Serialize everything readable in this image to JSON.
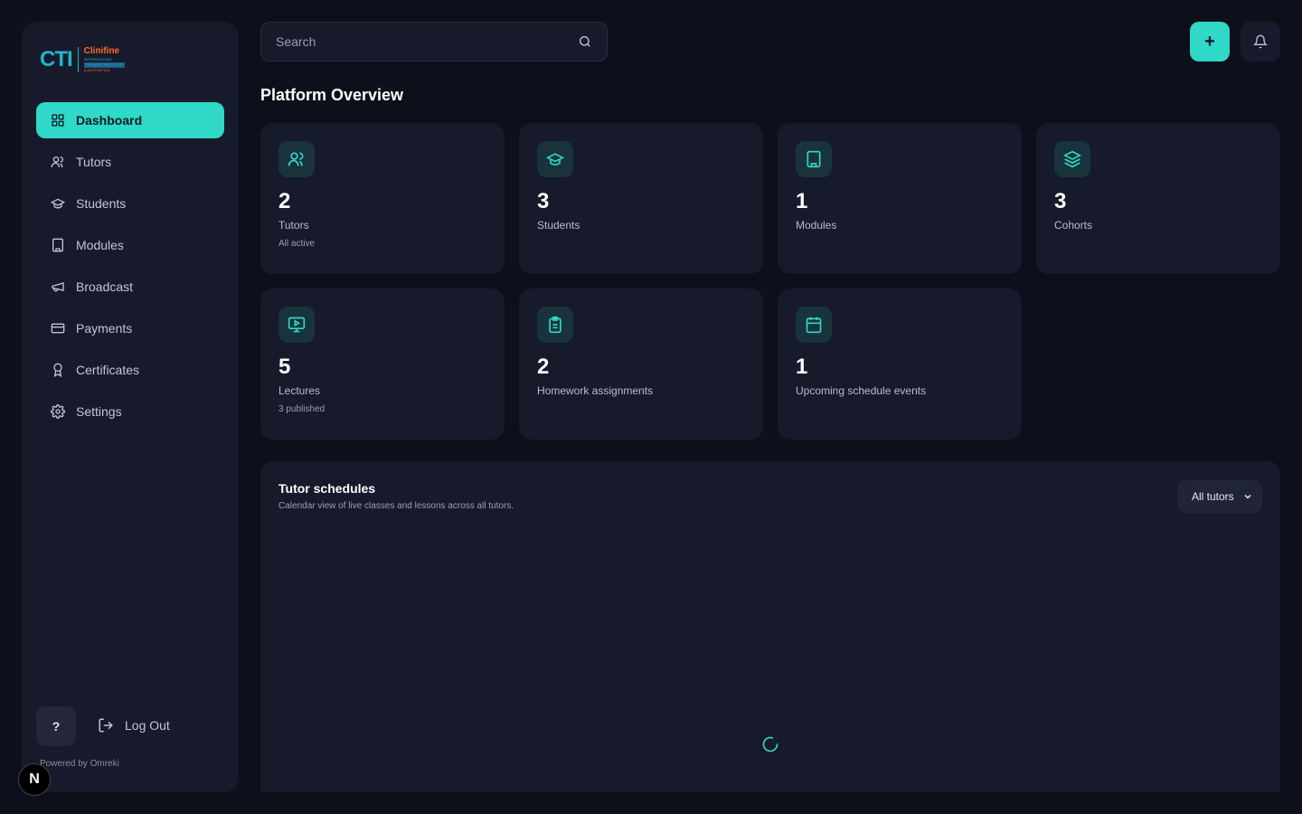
{
  "brand": {
    "mark": "CTI",
    "name": "Clinifine",
    "line2": "INTERNATIONAL",
    "line3": "TRAINING INSTITUTE",
    "line4": "& AESTHETICS",
    "primary_color": "#2fd8c7",
    "logo_orange": "#ff6a2a",
    "logo_blue": "#1fb6c9"
  },
  "sidebar": {
    "items": [
      {
        "label": "Dashboard",
        "icon": "grid-icon",
        "active": true
      },
      {
        "label": "Tutors",
        "icon": "users-icon"
      },
      {
        "label": "Students",
        "icon": "graduation-cap-icon"
      },
      {
        "label": "Modules",
        "icon": "building-icon"
      },
      {
        "label": "Broadcast",
        "icon": "megaphone-icon"
      },
      {
        "label": "Payments",
        "icon": "credit-card-icon"
      },
      {
        "label": "Certificates",
        "icon": "award-icon"
      },
      {
        "label": "Settings",
        "icon": "gear-icon"
      }
    ],
    "help_label": "?",
    "logout_label": "Log Out",
    "powered_by": "Powered by Omreki",
    "next_badge": "N"
  },
  "header": {
    "search_placeholder": "Search",
    "add_label": "+"
  },
  "page_title": "Platform Overview",
  "stats": [
    {
      "value": "2",
      "label": "Tutors",
      "sub": "All active",
      "icon": "users-icon"
    },
    {
      "value": "3",
      "label": "Students",
      "sub": "",
      "icon": "graduation-cap-icon"
    },
    {
      "value": "1",
      "label": "Modules",
      "sub": "",
      "icon": "building-icon"
    },
    {
      "value": "3",
      "label": "Cohorts",
      "sub": "",
      "icon": "layers-icon"
    },
    {
      "value": "5",
      "label": "Lectures",
      "sub": "3 published",
      "icon": "presentation-icon"
    },
    {
      "value": "2",
      "label": "Homework assignments",
      "sub": "",
      "icon": "clipboard-icon"
    },
    {
      "value": "1",
      "label": "Upcoming schedule events",
      "sub": "",
      "icon": "calendar-icon"
    }
  ],
  "schedules": {
    "title": "Tutor schedules",
    "subtitle": "Calendar view of live classes and lessons across all tutors.",
    "filter_value": "All tutors"
  }
}
